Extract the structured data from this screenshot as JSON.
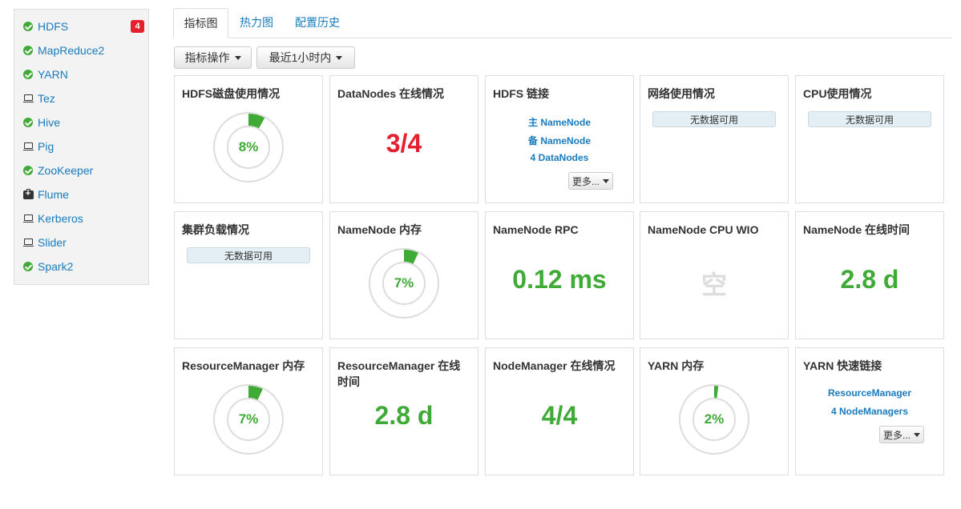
{
  "sidebar": {
    "items": [
      {
        "label": "HDFS",
        "icon": "ok-icon",
        "badge": "4"
      },
      {
        "label": "MapReduce2",
        "icon": "ok-icon"
      },
      {
        "label": "YARN",
        "icon": "ok-icon"
      },
      {
        "label": "Tez",
        "icon": "laptop-icon"
      },
      {
        "label": "Hive",
        "icon": "ok-icon"
      },
      {
        "label": "Pig",
        "icon": "laptop-icon"
      },
      {
        "label": "ZooKeeper",
        "icon": "ok-icon"
      },
      {
        "label": "Flume",
        "icon": "medkit-icon"
      },
      {
        "label": "Kerberos",
        "icon": "laptop-icon"
      },
      {
        "label": "Slider",
        "icon": "laptop-icon"
      },
      {
        "label": "Spark2",
        "icon": "ok-icon"
      }
    ]
  },
  "tabs": [
    "指标图",
    "热力图",
    "配置历史"
  ],
  "toolbar": {
    "metrics_actions": "指标操作",
    "time_range": "最近1小时内"
  },
  "widgets": {
    "hdfs_disk": {
      "title": "HDFS磁盘使用情况",
      "percent_label": "8%",
      "percent": 8
    },
    "datanodes": {
      "title": "DataNodes 在线情况",
      "value": "3/4"
    },
    "hdfs_links": {
      "title": "HDFS 链接",
      "links": [
        "主 NameNode",
        "备 NameNode",
        "4 DataNodes"
      ],
      "more": "更多..."
    },
    "network": {
      "title": "网络使用情况",
      "nodata": "无数据可用"
    },
    "cpu": {
      "title": "CPU使用情况",
      "nodata": "无数据可用"
    },
    "cluster_load": {
      "title": "集群负载情况",
      "nodata": "无数据可用"
    },
    "nn_memory": {
      "title": "NameNode 内存",
      "percent_label": "7%",
      "percent": 7
    },
    "nn_rpc": {
      "title": "NameNode RPC",
      "value": "0.12 ms"
    },
    "nn_cpu_wio": {
      "title": "NameNode CPU WIO",
      "value": "空"
    },
    "nn_uptime": {
      "title": "NameNode 在线时间",
      "value": "2.8 d"
    },
    "rm_memory": {
      "title": "ResourceManager 内存",
      "percent_label": "7%",
      "percent": 7
    },
    "rm_uptime": {
      "title": "ResourceManager 在线时间",
      "value": "2.8 d"
    },
    "nm_online": {
      "title": "NodeManager 在线情况",
      "value": "4/4"
    },
    "yarn_memory": {
      "title": "YARN 内存",
      "percent_label": "2%",
      "percent": 2
    },
    "yarn_links": {
      "title": "YARN 快速链接",
      "links": [
        "ResourceManager",
        "4 NodeManagers"
      ],
      "more": "更多..."
    }
  },
  "colors": {
    "accent": "#1a7bbd",
    "ok": "#3fab36",
    "alert": "#e5202e",
    "nodata_bg": "#e3eff5"
  }
}
